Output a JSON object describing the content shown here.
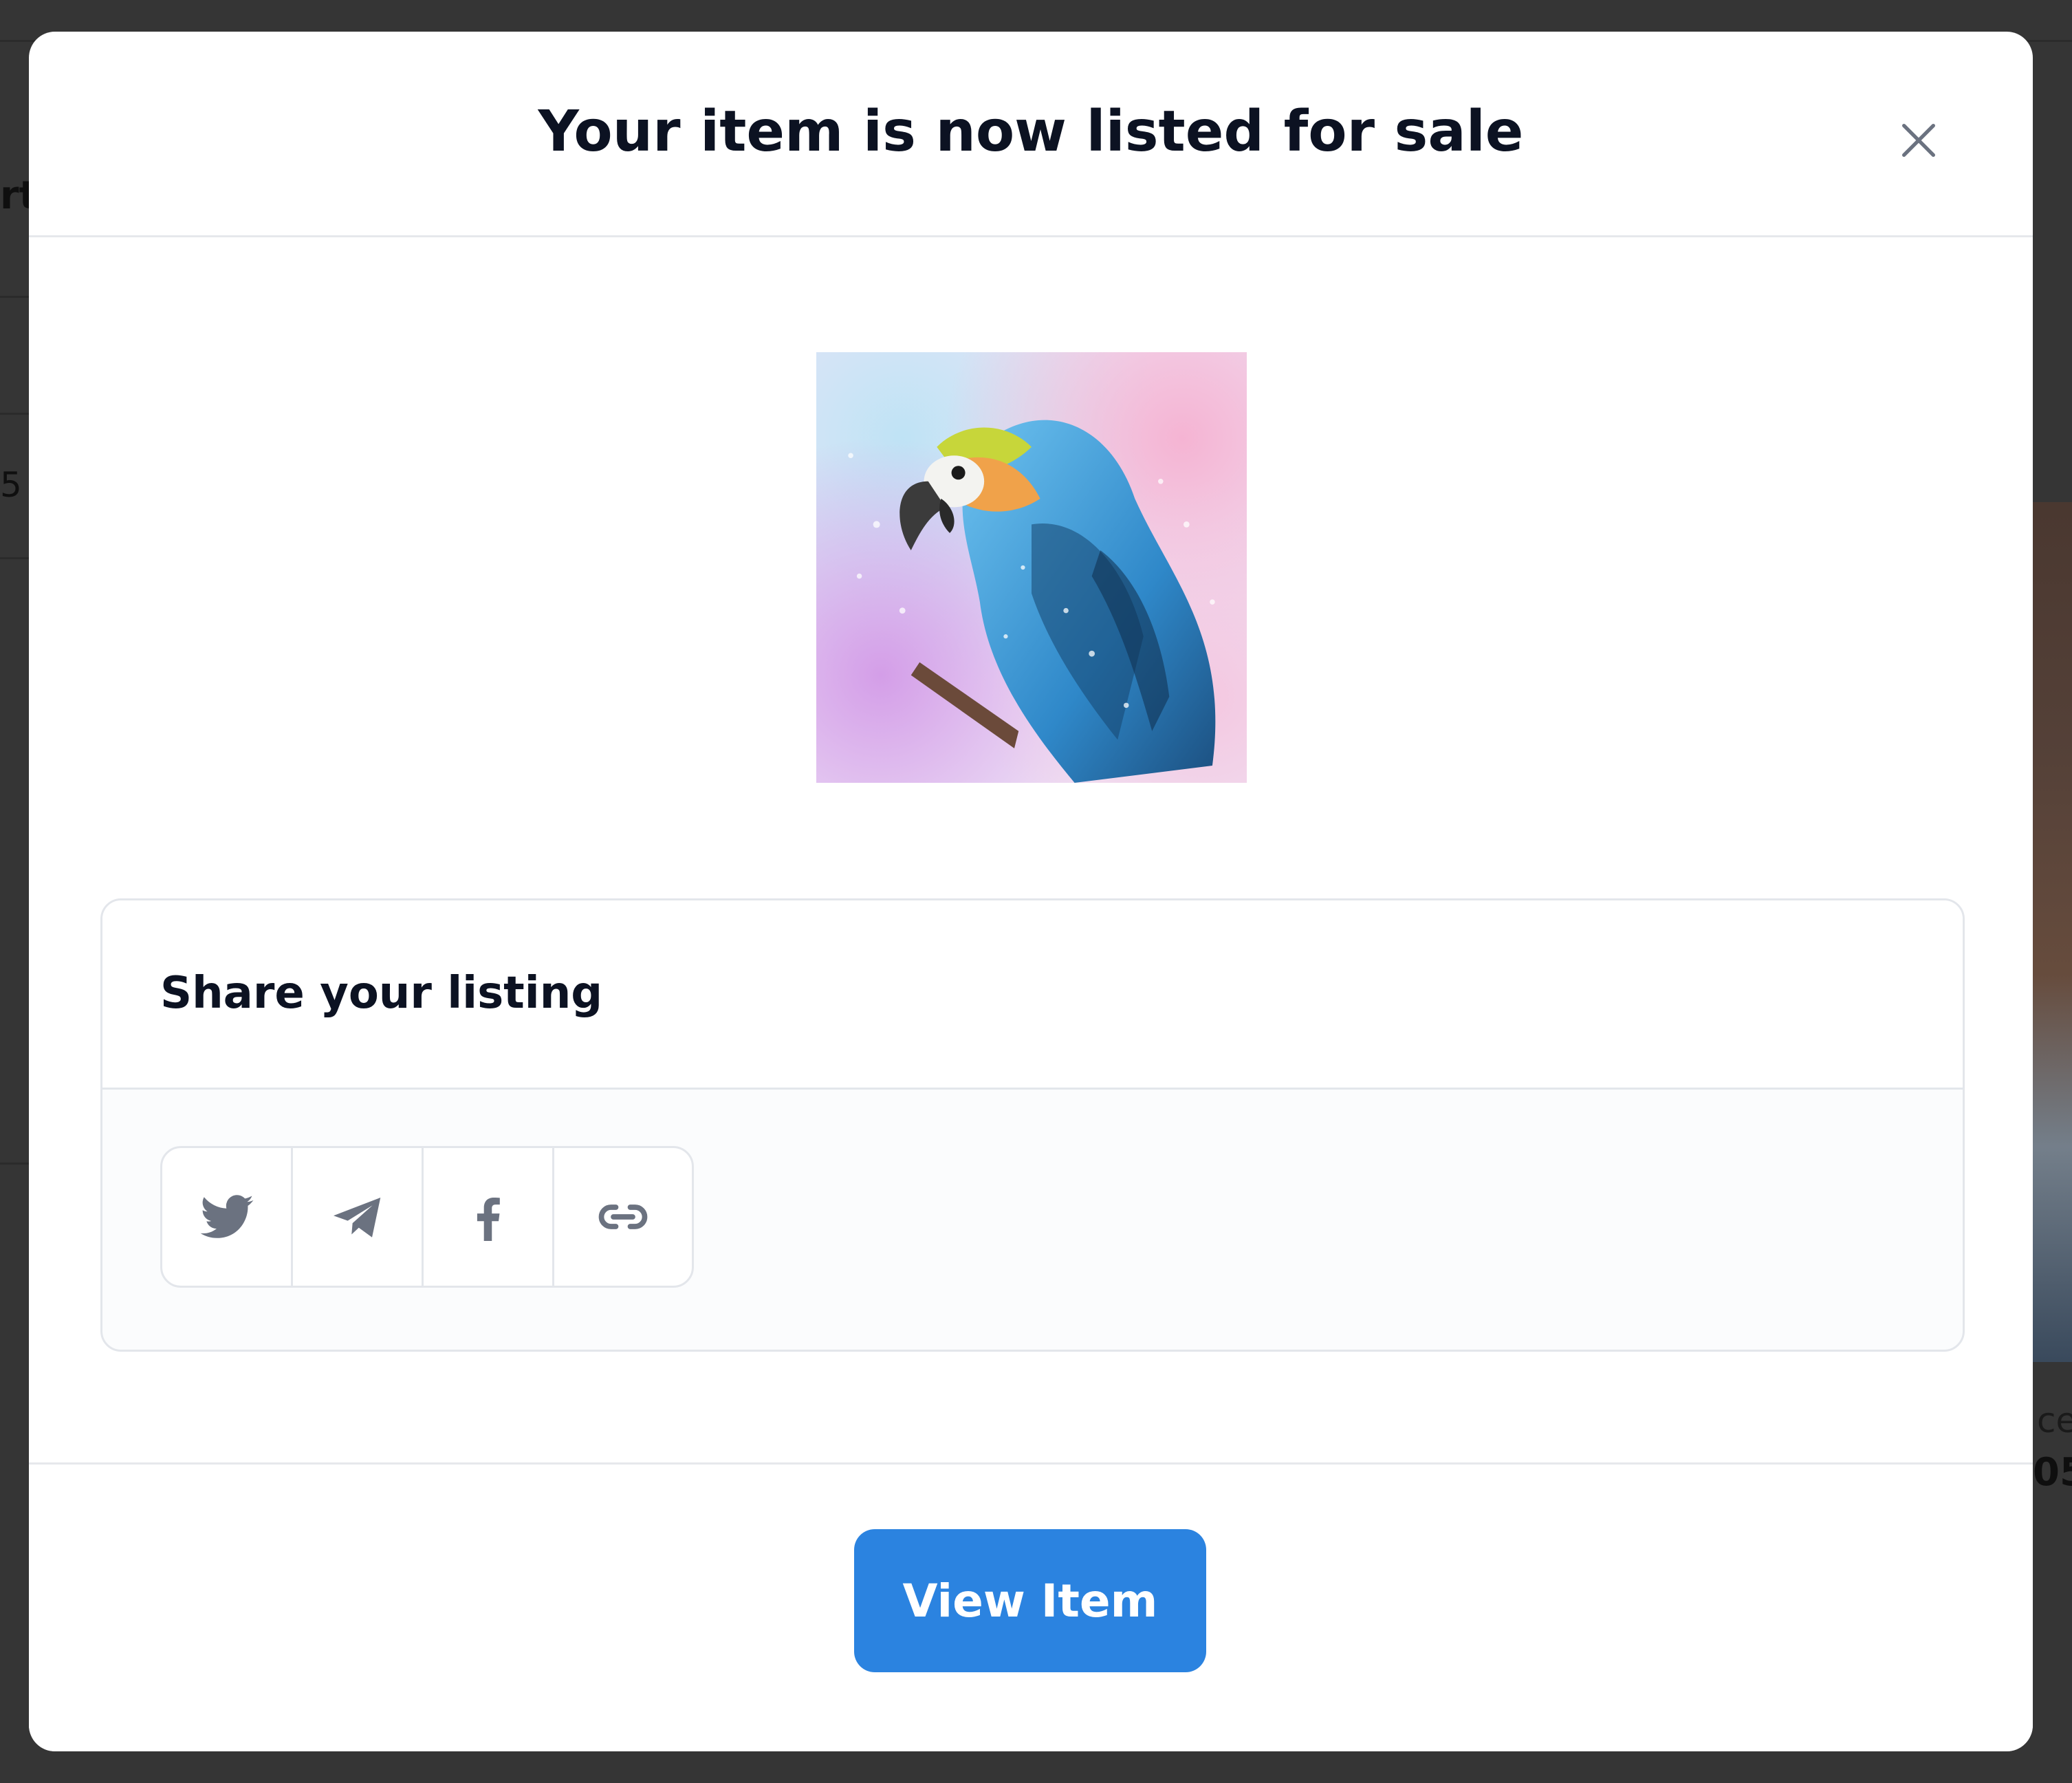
{
  "background": {
    "fragments": [
      "rt",
      "5",
      "ce",
      "05"
    ]
  },
  "modal": {
    "title": "Your item is now listed for sale",
    "close_icon": "close-icon",
    "image_alt": "parrot-artwork"
  },
  "share": {
    "title": "Share your listing",
    "buttons": [
      {
        "name": "twitter",
        "icon": "twitter-icon"
      },
      {
        "name": "telegram",
        "icon": "telegram-icon"
      },
      {
        "name": "facebook",
        "icon": "facebook-icon"
      },
      {
        "name": "copy-link",
        "icon": "link-icon"
      }
    ]
  },
  "footer": {
    "view_item_label": "View Item"
  },
  "colors": {
    "primary_button": "#2b83e0",
    "title_text": "#0c1222",
    "icon_gray": "#6b7280",
    "border": "#e3e6eb"
  }
}
